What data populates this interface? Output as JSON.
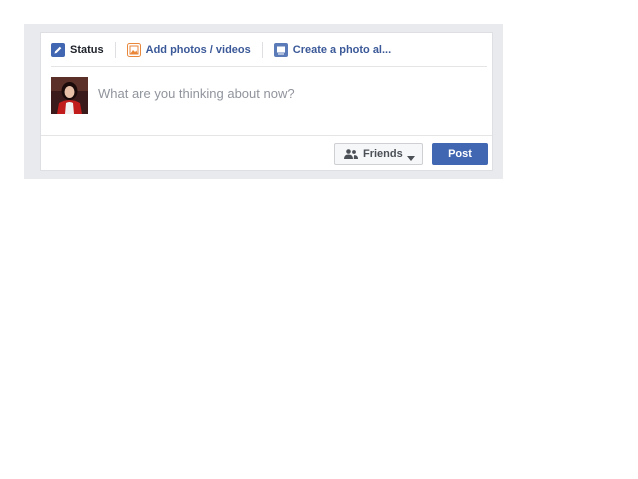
{
  "composer": {
    "tabs": [
      {
        "label": "Status",
        "icon": "pencil-icon",
        "active": true
      },
      {
        "label": "Add photos / videos",
        "icon": "photo-icon",
        "active": false
      },
      {
        "label": "Create a photo al...",
        "icon": "album-icon",
        "active": false
      }
    ],
    "status_placeholder": "What are you thinking about now?",
    "audience_label": "Friends",
    "audience_icon": "friends-icon",
    "post_label": "Post"
  },
  "colors": {
    "brand_blue": "#4267b2",
    "link_blue": "#3b5998",
    "frame_gray": "#e9eaed",
    "photo_tab_orange": "#e9873b"
  }
}
